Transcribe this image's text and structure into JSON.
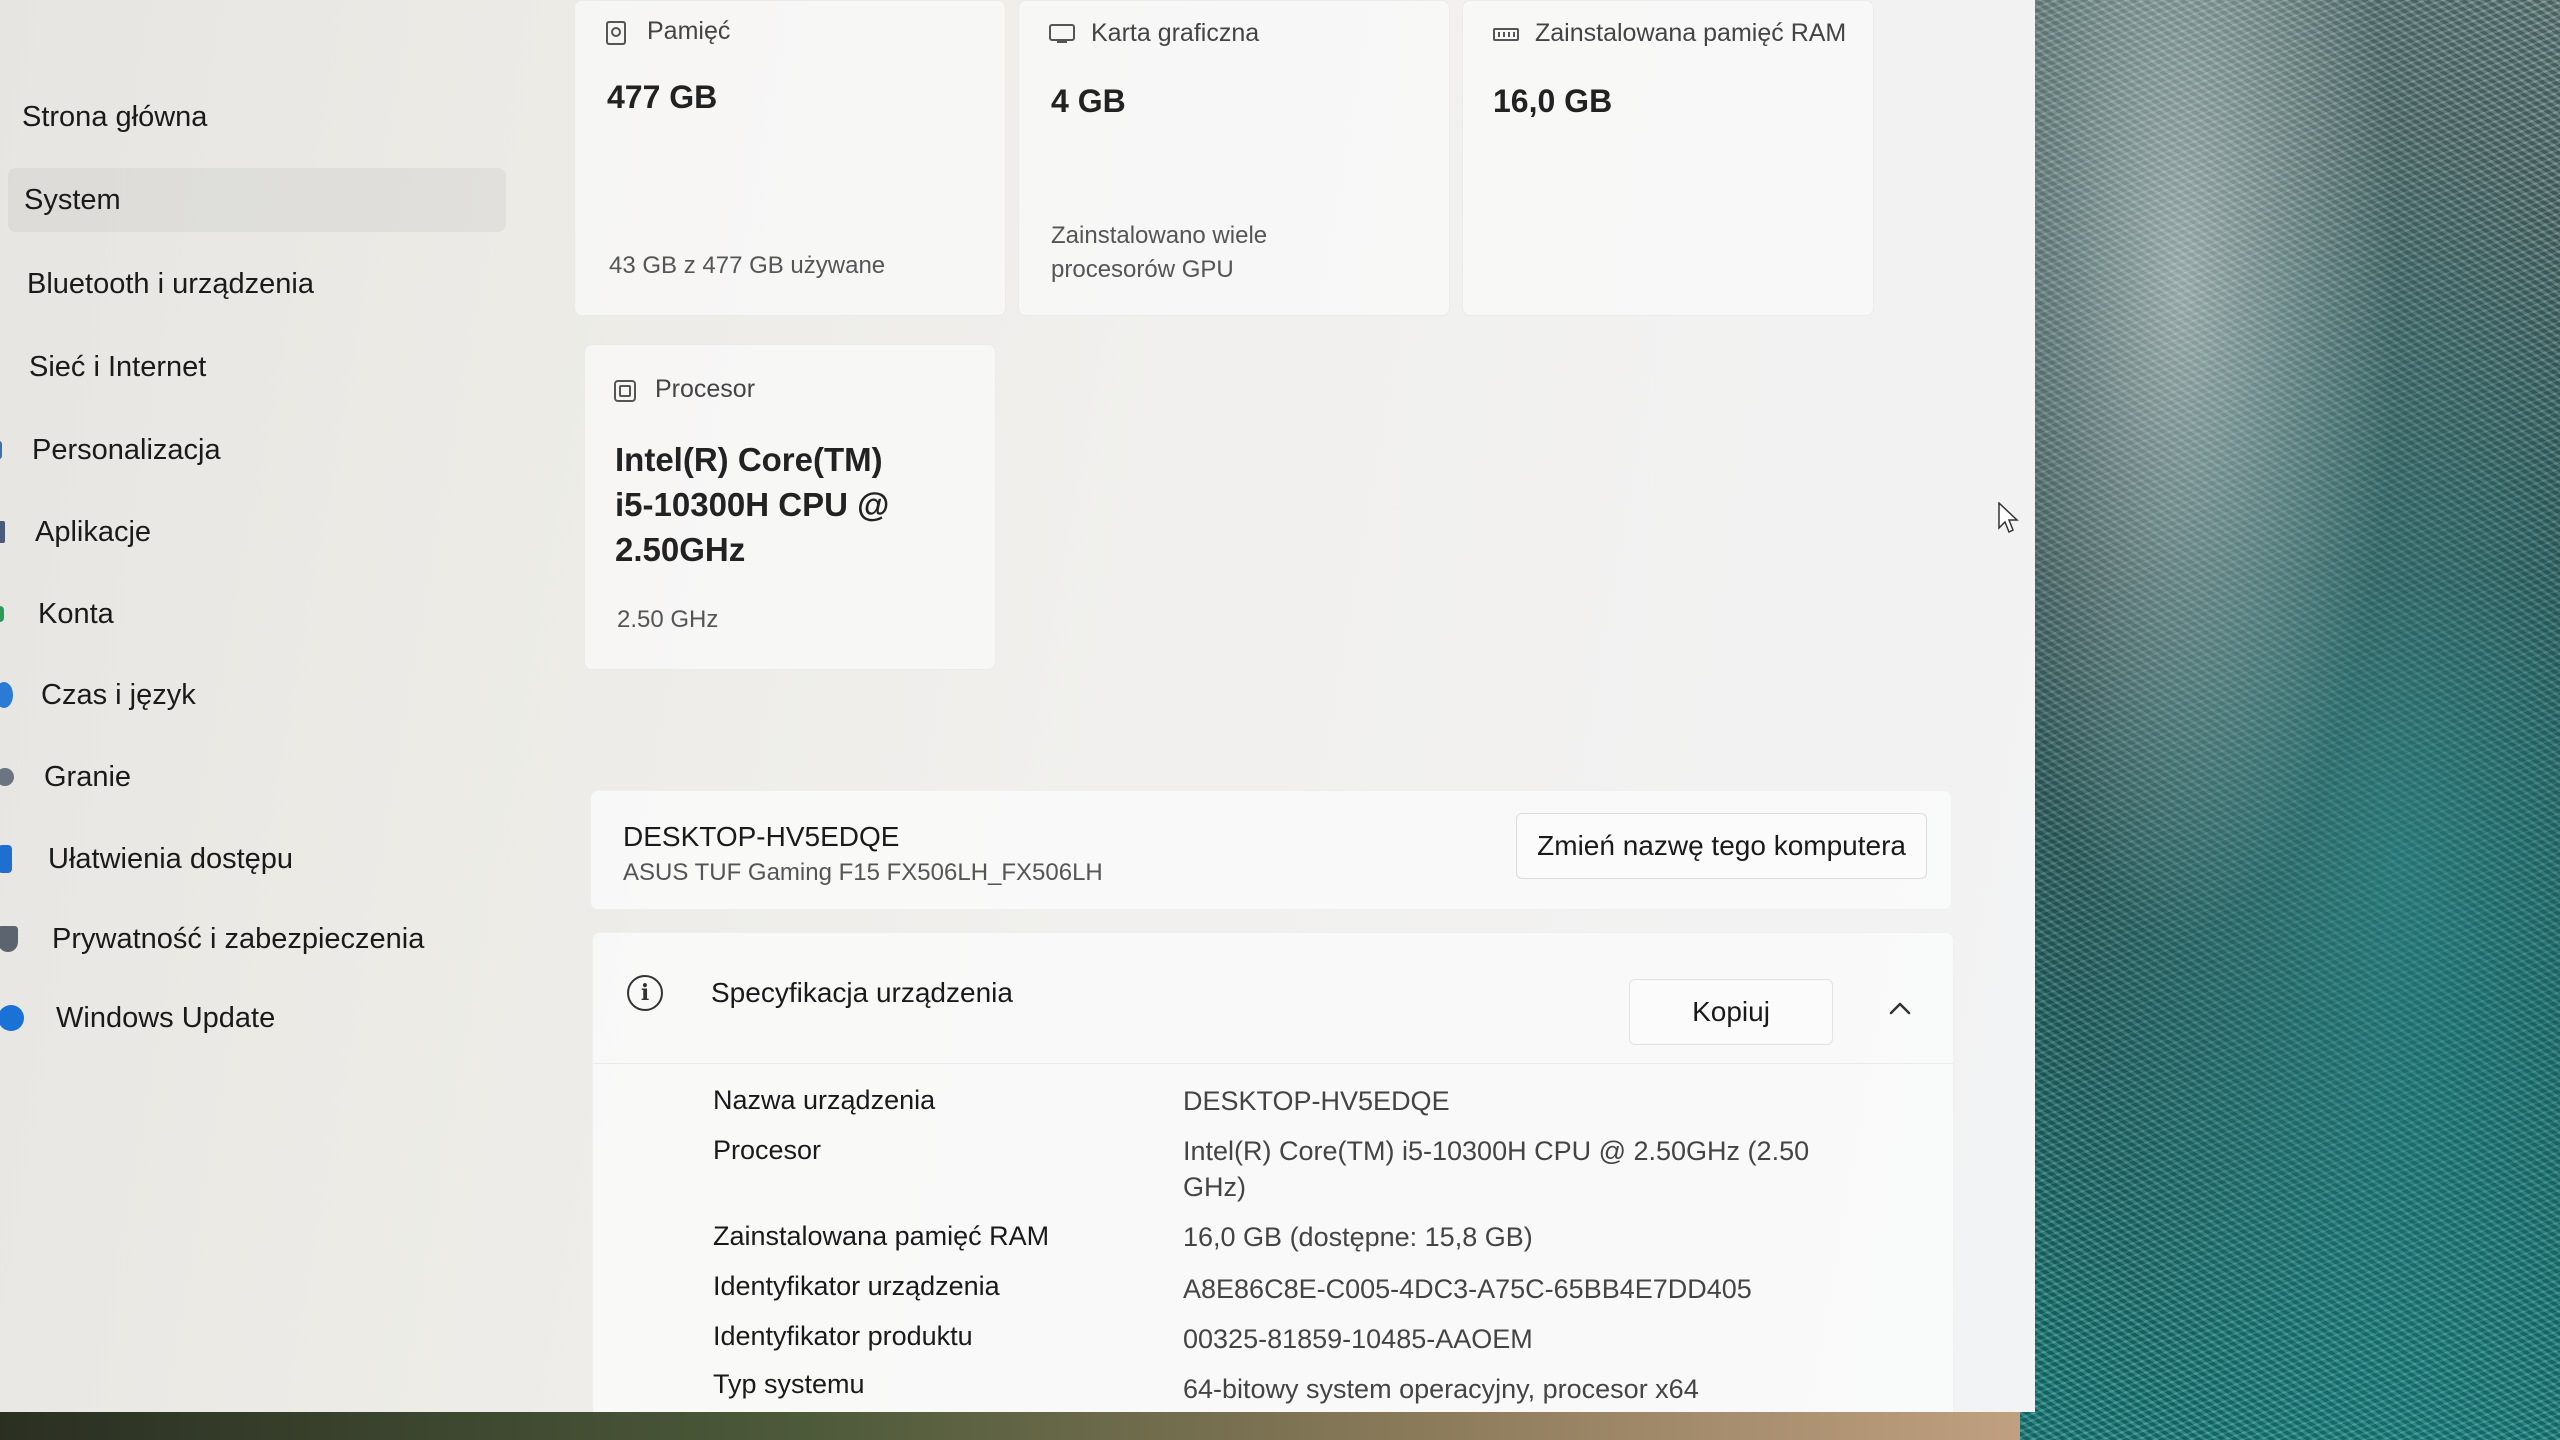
{
  "sidebar": {
    "items": [
      {
        "label": "Strona główna"
      },
      {
        "label": "System"
      },
      {
        "label": "Bluetooth i urządzenia"
      },
      {
        "label": "Sieć i Internet"
      },
      {
        "label": "Personalizacja"
      },
      {
        "label": "Aplikacje"
      },
      {
        "label": "Konta"
      },
      {
        "label": "Czas i język"
      },
      {
        "label": "Granie"
      },
      {
        "label": "Ułatwienia dostępu"
      },
      {
        "label": "Prywatność i zabezpieczenia"
      },
      {
        "label": "Windows Update"
      }
    ],
    "selected": "System"
  },
  "cards": {
    "storage": {
      "label": "Pamięć",
      "value": "477 GB",
      "sub": "43 GB z 477 GB używane"
    },
    "gpu": {
      "label": "Karta graficzna",
      "value": "4 GB",
      "sub": "Zainstalowano wiele procesorów GPU"
    },
    "ram": {
      "label": "Zainstalowana pamięć RAM",
      "value": "16,0 GB"
    },
    "cpu": {
      "label": "Procesor",
      "value": "Intel(R) Core(TM) i5-10300H CPU @ 2.50GHz",
      "sub": "2.50 GHz"
    }
  },
  "device": {
    "name": "DESKTOP-HV5EDQE",
    "model": "ASUS TUF Gaming F15 FX506LH_FX506LH",
    "rename_label": "Zmień nazwę tego komputera"
  },
  "specs": {
    "title": "Specyfikacja urządzenia",
    "copy_label": "Kopiuj",
    "rows": [
      {
        "label": "Nazwa urządzenia",
        "value": "DESKTOP-HV5EDQE"
      },
      {
        "label": "Procesor",
        "value": "Intel(R) Core(TM) i5-10300H CPU @ 2.50GHz (2.50 GHz)"
      },
      {
        "label": "Zainstalowana pamięć RAM",
        "value": "16,0 GB (dostępne: 15,8 GB)"
      },
      {
        "label": "Identyfikator urządzenia",
        "value": "A8E86C8E-C005-4DC3-A75C-65BB4E7DD405"
      },
      {
        "label": "Identyfikator produktu",
        "value": "00325-81859-10485-AAOEM"
      },
      {
        "label": "Typ systemu",
        "value": "64-bitowy system operacyjny, procesor x64"
      }
    ]
  },
  "icons": {
    "storage": "drive-icon",
    "gpu": "display-icon",
    "ram": "memory-icon",
    "cpu": "chip-icon",
    "info": "info-icon",
    "collapse": "chevron-up-icon"
  },
  "colors": {
    "accent": "#0067c0",
    "window_bg": "#f0efed"
  }
}
